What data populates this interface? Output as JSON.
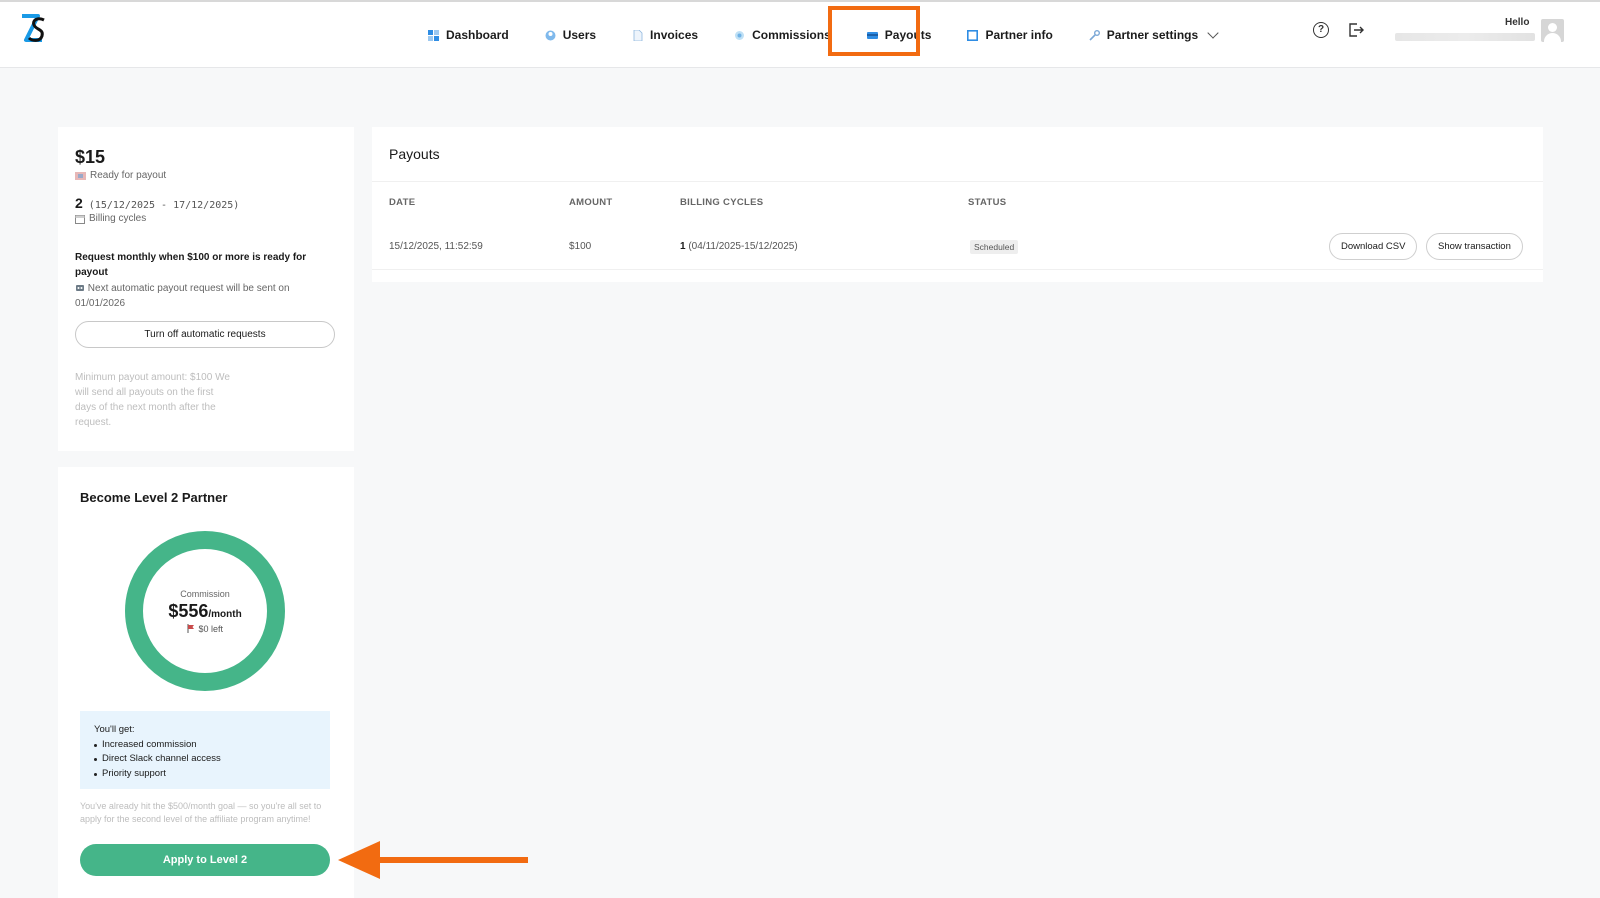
{
  "header": {
    "nav": [
      {
        "label": "Dashboard",
        "icon": "dashboard-icon"
      },
      {
        "label": "Users",
        "icon": "users-icon"
      },
      {
        "label": "Invoices",
        "icon": "invoice-icon"
      },
      {
        "label": "Commissions",
        "icon": "commission-icon"
      },
      {
        "label": "Payouts",
        "icon": "payout-icon"
      },
      {
        "label": "Partner info",
        "icon": "partner-info-icon"
      },
      {
        "label": "Partner settings",
        "icon": "wrench-icon"
      }
    ],
    "active": "Payouts",
    "greeting": "Hello",
    "accent_highlight": "#f26b11"
  },
  "summary": {
    "amount": "$15",
    "amount_label": "Ready for payout",
    "cycles": "2",
    "cycle_range": "(15/12/2025 - 17/12/2025)",
    "cycles_label": "Billing cycles",
    "request_title": "Request monthly when $100 or more is ready for payout",
    "next_request": "Next automatic payout request will be sent on 01/01/2026",
    "toggle_button": "Turn off automatic requests",
    "min_note": "Minimum payout amount: $100 We will send all payouts on the first days of the next month after the request."
  },
  "level": {
    "title": "Become Level 2 Partner",
    "ring_label": "Commission",
    "ring_value": "$556",
    "ring_unit": "/month",
    "ring_left": "$0 left",
    "progress": 1.0,
    "benefits_title": "You'll get:",
    "benefits": [
      "Increased commission",
      "Direct Slack channel access",
      "Priority support"
    ],
    "goal_note": "You've already hit the $500/month goal — so you're all set to apply for the second level of the affiliate program anytime!",
    "apply_button": "Apply to Level 2",
    "accent": "#45b589"
  },
  "payouts": {
    "title": "Payouts",
    "columns": [
      "DATE",
      "AMOUNT",
      "BILLING CYCLES",
      "STATUS"
    ],
    "rows": [
      {
        "date": "15/12/2025, 11:52:59",
        "amount": "$100",
        "cycles_count": "1",
        "cycles_range": "(04/11/2025-15/12/2025)",
        "status": "Scheduled"
      }
    ],
    "download_button": "Download CSV",
    "show_button": "Show transaction"
  }
}
